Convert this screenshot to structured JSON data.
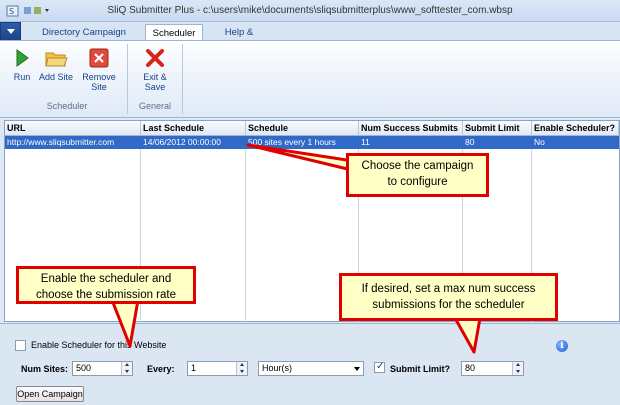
{
  "window": {
    "title": "SliQ Submitter Plus - c:\\users\\mike\\documents\\sliqsubmitterplus\\www_softtester_com.wbsp"
  },
  "ribbon": {
    "tabs": [
      {
        "label": "Directory Campaign Manager"
      },
      {
        "label": "Scheduler",
        "active": true
      },
      {
        "label": "Help & Support"
      }
    ],
    "buttons": {
      "run": "Run",
      "add_site": "Add Site",
      "remove_site": "Remove Site",
      "exit_save": "Exit & Save"
    },
    "groups": {
      "scheduler": "Scheduler",
      "general": "General"
    }
  },
  "grid": {
    "columns": [
      "URL",
      "Last Schedule",
      "Schedule",
      "Num Success Submits",
      "Submit Limit",
      "Enable Scheduler?"
    ],
    "rows": [
      {
        "url": "http://www.sliqsubmitter.com",
        "last_schedule": "14/06/2012 00:00:00",
        "schedule": "500 sites every 1 hours",
        "num_success": "11",
        "submit_limit": "80",
        "enable": "No",
        "selected": true
      }
    ]
  },
  "settings": {
    "enable_label": "Enable Scheduler for this Website",
    "enable_checked": false,
    "num_sites_label": "Num Sites:",
    "num_sites_value": "500",
    "every_label": "Every:",
    "every_value": "1",
    "interval_value": "Hour(s)",
    "submit_limit_label": "Submit Limit?",
    "submit_limit_checked": true,
    "submit_limit_value": "80",
    "open_campaign": "Open Campaign"
  },
  "annotations": {
    "choose_campaign": [
      "Choose the campaign",
      "to configure"
    ],
    "enable_scheduler": [
      "Enable the scheduler and",
      "choose the submission rate"
    ],
    "max_submissions": [
      "If desired, set a max num success",
      "submissions for the scheduler"
    ]
  },
  "colors": {
    "selection": "#3169c6",
    "callout_border": "#e00000",
    "callout_fill": "#ffffc6"
  }
}
